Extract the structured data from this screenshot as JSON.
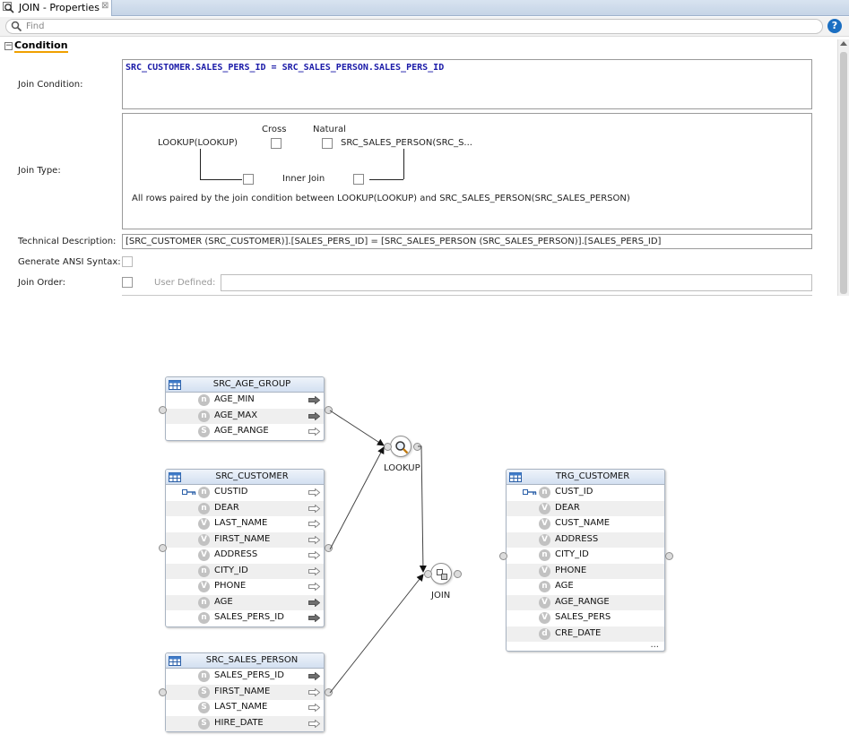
{
  "panel": {
    "tab_title": "JOIN - Properties",
    "tab_close": "⊠",
    "find_placeholder": "Find",
    "help": "?",
    "section": {
      "toggle": "−",
      "title": "Condition"
    },
    "join_condition": {
      "label": "Join Condition:",
      "value": "SRC_CUSTOMER.SALES_PERS_ID = SRC_SALES_PERSON.SALES_PERS_ID"
    },
    "join_type": {
      "label": "Join Type:",
      "cross_label": "Cross",
      "natural_label": "Natural",
      "left_source": "LOOKUP(LOOKUP)",
      "right_source": "SRC_SALES_PERSON(SRC_S...",
      "inner_join_label": "Inner Join",
      "description": "All rows paired by the join condition between LOOKUP(LOOKUP) and SRC_SALES_PERSON(SRC_SALES_PERSON)"
    },
    "technical_description": {
      "label": "Technical Description:",
      "value": "[SRC_CUSTOMER (SRC_CUSTOMER)].[SALES_PERS_ID] = [SRC_SALES_PERSON (SRC_SALES_PERSON)].[SALES_PERS_ID]"
    },
    "generate_ansi": {
      "label": "Generate ANSI Syntax:"
    },
    "join_order": {
      "label": "Join Order:",
      "user_defined_label": "User Defined:"
    }
  },
  "diagram": {
    "datastores": [
      {
        "title": "SRC_AGE_GROUP",
        "columns": [
          {
            "name": "AGE_MIN",
            "type": "n",
            "key": false,
            "mapped": true
          },
          {
            "name": "AGE_MAX",
            "type": "n",
            "key": false,
            "mapped": true
          },
          {
            "name": "AGE_RANGE",
            "type": "S",
            "key": false,
            "mapped": false
          }
        ]
      },
      {
        "title": "SRC_CUSTOMER",
        "columns": [
          {
            "name": "CUSTID",
            "type": "n",
            "key": true,
            "mapped": false
          },
          {
            "name": "DEAR",
            "type": "n",
            "key": false,
            "mapped": false
          },
          {
            "name": "LAST_NAME",
            "type": "V",
            "key": false,
            "mapped": false
          },
          {
            "name": "FIRST_NAME",
            "type": "V",
            "key": false,
            "mapped": false
          },
          {
            "name": "ADDRESS",
            "type": "V",
            "key": false,
            "mapped": false
          },
          {
            "name": "CITY_ID",
            "type": "n",
            "key": false,
            "mapped": false
          },
          {
            "name": "PHONE",
            "type": "V",
            "key": false,
            "mapped": false
          },
          {
            "name": "AGE",
            "type": "n",
            "key": false,
            "mapped": true
          },
          {
            "name": "SALES_PERS_ID",
            "type": "n",
            "key": false,
            "mapped": true
          }
        ]
      },
      {
        "title": "SRC_SALES_PERSON",
        "columns": [
          {
            "name": "SALES_PERS_ID",
            "type": "n",
            "key": false,
            "mapped": true
          },
          {
            "name": "FIRST_NAME",
            "type": "S",
            "key": false,
            "mapped": false
          },
          {
            "name": "LAST_NAME",
            "type": "S",
            "key": false,
            "mapped": false
          },
          {
            "name": "HIRE_DATE",
            "type": "S",
            "key": false,
            "mapped": false
          }
        ]
      },
      {
        "title": "TRG_CUSTOMER",
        "more": "...",
        "columns": [
          {
            "name": "CUST_ID",
            "type": "n",
            "key": true
          },
          {
            "name": "DEAR",
            "type": "V",
            "key": false
          },
          {
            "name": "CUST_NAME",
            "type": "V",
            "key": false
          },
          {
            "name": "ADDRESS",
            "type": "V",
            "key": false
          },
          {
            "name": "CITY_ID",
            "type": "n",
            "key": false
          },
          {
            "name": "PHONE",
            "type": "V",
            "key": false
          },
          {
            "name": "AGE",
            "type": "n",
            "key": false
          },
          {
            "name": "AGE_RANGE",
            "type": "V",
            "key": false
          },
          {
            "name": "SALES_PERS",
            "type": "V",
            "key": false
          },
          {
            "name": "CRE_DATE",
            "type": "d",
            "key": false
          }
        ]
      }
    ],
    "components": [
      {
        "label": "LOOKUP",
        "icon": "magnifier-icon"
      },
      {
        "label": "JOIN",
        "icon": "join-icon"
      }
    ]
  }
}
